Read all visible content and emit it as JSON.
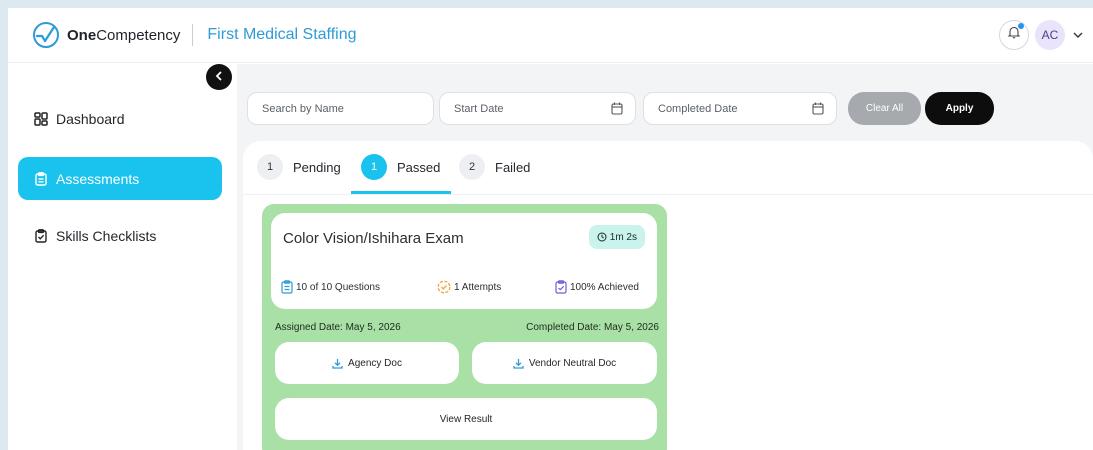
{
  "header": {
    "logo_brand_bold": "One",
    "logo_brand_rest": "Competency",
    "org_name": "First Medical Staffing",
    "avatar_initials": "AC",
    "icons": [
      "logo-icon",
      "bell-icon",
      "chevron-down-icon"
    ],
    "accent_color": "#2d9bd6",
    "notification_dot_color": "#2196f3"
  },
  "sidebar": {
    "items": [
      {
        "label": "Dashboard",
        "icon": "grid-icon",
        "active": false
      },
      {
        "label": "Assessments",
        "icon": "clipboard-icon",
        "active": true
      },
      {
        "label": "Skills Checklists",
        "icon": "clipboard-check-icon",
        "active": false
      }
    ],
    "active_color": "#19c3ee"
  },
  "filters": {
    "search_placeholder": "Search by Name",
    "start_date_placeholder": "Start Date",
    "completed_date_placeholder": "Completed Date",
    "clear_label": "Clear All",
    "apply_label": "Apply"
  },
  "tabs": [
    {
      "count": "1",
      "label": "Pending",
      "active": false
    },
    {
      "count": "1",
      "label": "Passed",
      "active": true
    },
    {
      "count": "2",
      "label": "Failed",
      "active": false
    }
  ],
  "card": {
    "title": "Color Vision/Ishihara Exam",
    "duration": "1m 2s",
    "questions": "10 of 10 Questions",
    "attempts": "1 Attempts",
    "achieved": "100% Achieved",
    "assigned_date": "Assigned Date: May 5, 2026",
    "completed_date": "Completed Date: May 5, 2026",
    "agency_doc_label": "Agency Doc",
    "vendor_doc_label": "Vendor Neutral Doc",
    "view_result_label": "View Result",
    "background_color": "#a8e0a6"
  }
}
